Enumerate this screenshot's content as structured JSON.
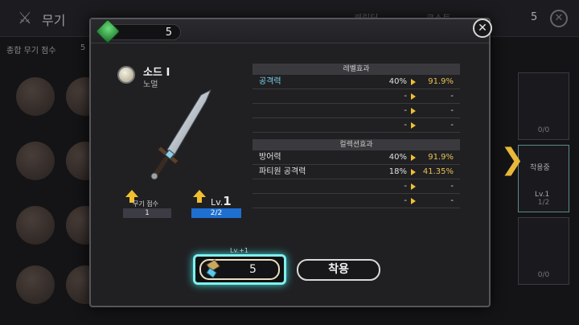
{
  "background": {
    "title": "무기",
    "total_score_label": "종합 무기 점수",
    "total_score_value": "5",
    "tab_1": "캐릭터",
    "tab_2": "코스트",
    "resource_count": "5",
    "slot_counts": [
      "0/0",
      "0/0",
      "1/2"
    ],
    "slot_equipped": "착용중",
    "slot_level": "Lv.1"
  },
  "modal": {
    "gem_count": "5",
    "weapon": {
      "name": "소드 I",
      "grade": "노멀",
      "score_label": "무기 점수",
      "score_value": "1",
      "level_prefix": "Lv.",
      "level_value": "1",
      "progress_text": "2/2",
      "progress_fraction": 1.0
    },
    "level_effect": {
      "header": "레벨효과",
      "rows": [
        {
          "name": "공격력",
          "current": "40%",
          "next": "91.9%"
        },
        {
          "name": "",
          "current": "-",
          "next": "-"
        },
        {
          "name": "",
          "current": "-",
          "next": "-"
        },
        {
          "name": "",
          "current": "-",
          "next": "-"
        }
      ]
    },
    "collection_effect": {
      "header": "컬렉션효과",
      "rows": [
        {
          "name": "방어력",
          "current": "40%",
          "next": "91.9%"
        },
        {
          "name": "파티원 공격력",
          "current": "18%",
          "next": "41.35%"
        },
        {
          "name": "",
          "current": "-",
          "next": "-"
        },
        {
          "name": "",
          "current": "-",
          "next": "-"
        }
      ]
    },
    "upgrade": {
      "label": "Lv.+1",
      "cost": "5"
    },
    "equip_label": "착용",
    "close_label": "✕"
  },
  "colors": {
    "accent_cyan": "#7ff0ee",
    "gold": "#f0c030",
    "progress_blue": "#1e6fd0",
    "stat_highlight": "#7fd3ee"
  }
}
